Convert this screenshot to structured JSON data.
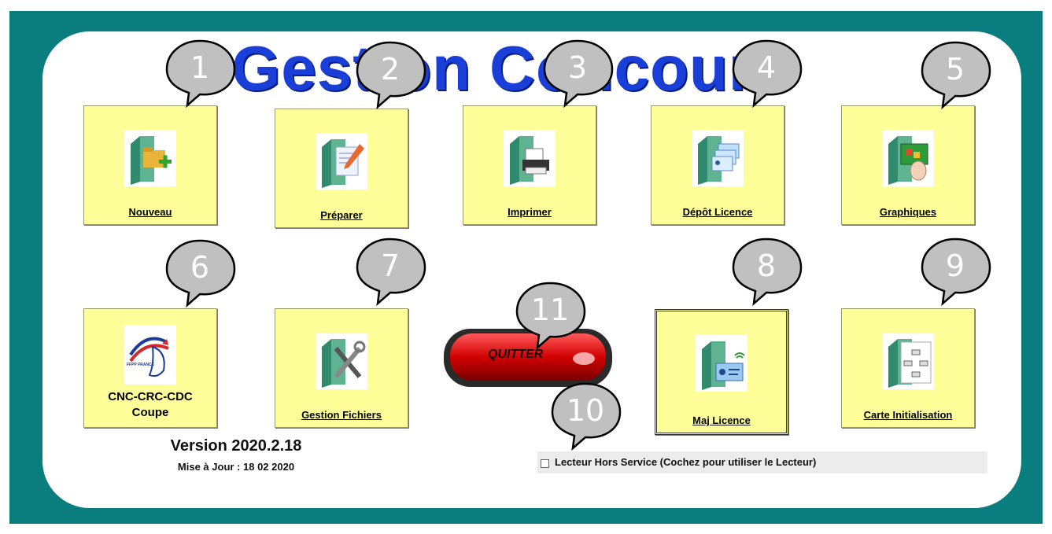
{
  "app": {
    "title": "Gestion Concours"
  },
  "tiles": [
    {
      "id": "nouveau",
      "label": "Nouveau",
      "icon": "folder-add-icon"
    },
    {
      "id": "preparer",
      "label": "Préparer",
      "icon": "folder-edit-icon"
    },
    {
      "id": "imprimer",
      "label": "Imprimer",
      "icon": "printer-icon"
    },
    {
      "id": "depot-licence",
      "label": "Dépôt Licence",
      "icon": "license-cards-icon"
    },
    {
      "id": "graphiques",
      "label": "Graphiques",
      "icon": "touch-graph-icon"
    },
    {
      "id": "cnc-crc-cdc",
      "label_line1": "CNC-CRC-CDC",
      "label_line2": "Coupe",
      "icon": "ffpp-rooster-logo"
    },
    {
      "id": "gestion-fichiers",
      "label": "Gestion Fichiers",
      "icon": "tools-icon"
    },
    {
      "id": "maj-licence",
      "label": "Maj Licence",
      "icon": "license-wireless-icon"
    },
    {
      "id": "carte-initialisation",
      "label": "Carte Initialisation",
      "icon": "org-chart-icon"
    }
  ],
  "logo_text": "FFPP FRANCE",
  "quit": {
    "label": "QUITTER"
  },
  "version": {
    "label": "Version 2020.2.18",
    "update": "Mise à Jour : 18 02 2020"
  },
  "reader": {
    "label": "Lecteur Hors Service (Cochez pour utiliser le Lecteur)",
    "checked": false
  },
  "callouts": [
    "1",
    "2",
    "3",
    "4",
    "5",
    "6",
    "7",
    "8",
    "9",
    "10",
    "11"
  ],
  "colors": {
    "frame": "#0a7e7e",
    "tile": "#ffff99",
    "title": "#1a3fd8",
    "callout": "#c0c0c0",
    "quit": "#cc0000"
  }
}
